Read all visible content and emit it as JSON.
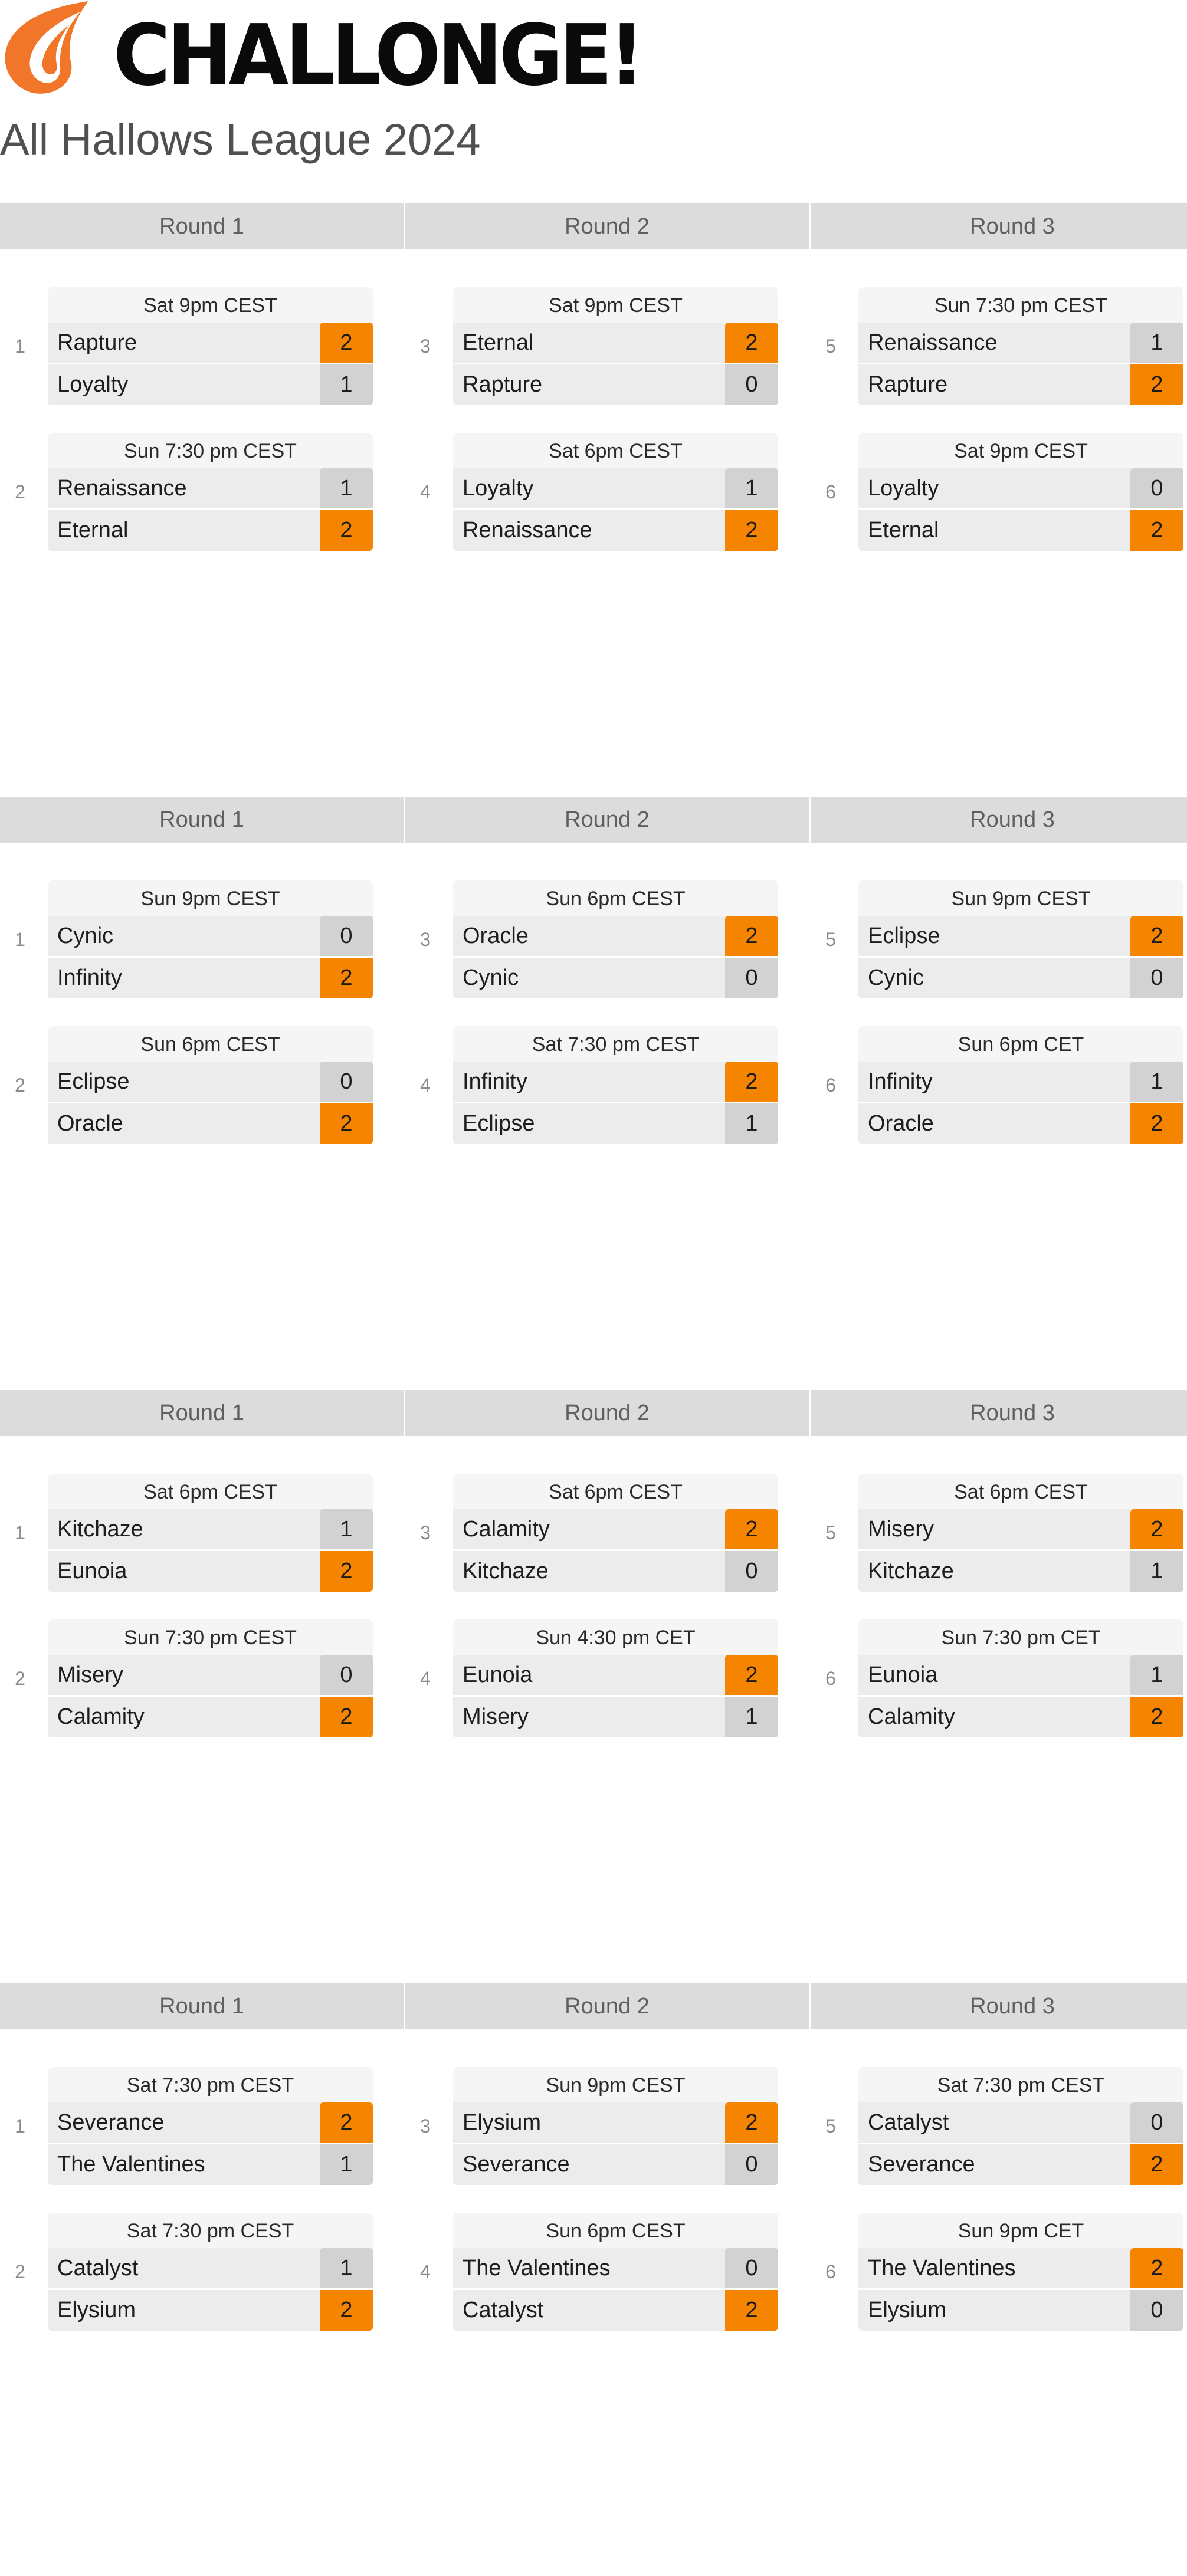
{
  "brand": {
    "name": "CHALLONGE!",
    "logo_icon": "challonge-flame-logo-icon",
    "accent_color": "#f58500"
  },
  "page": {
    "title": "All Hallows League 2024"
  },
  "groups": [
    {
      "rounds": [
        "Round 1",
        "Round 2",
        "Round 3"
      ],
      "matches": [
        {
          "num": "1",
          "time": "Sat 9pm CEST",
          "p1": "Rapture",
          "s1": "2",
          "w1": true,
          "p2": "Loyalty",
          "s2": "1",
          "w2": false
        },
        {
          "num": "2",
          "time": "Sun 7:30 pm CEST",
          "p1": "Renaissance",
          "s1": "1",
          "w1": false,
          "p2": "Eternal",
          "s2": "2",
          "w2": true
        },
        {
          "num": "3",
          "time": "Sat 9pm CEST",
          "p1": "Eternal",
          "s1": "2",
          "w1": true,
          "p2": "Rapture",
          "s2": "0",
          "w2": false
        },
        {
          "num": "4",
          "time": "Sat 6pm CEST",
          "p1": "Loyalty",
          "s1": "1",
          "w1": false,
          "p2": "Renaissance",
          "s2": "2",
          "w2": true
        },
        {
          "num": "5",
          "time": "Sun 7:30 pm CEST",
          "p1": "Renaissance",
          "s1": "1",
          "w1": false,
          "p2": "Rapture",
          "s2": "2",
          "w2": true
        },
        {
          "num": "6",
          "time": "Sat 9pm CEST",
          "p1": "Loyalty",
          "s1": "0",
          "w1": false,
          "p2": "Eternal",
          "s2": "2",
          "w2": true
        }
      ]
    },
    {
      "rounds": [
        "Round 1",
        "Round 2",
        "Round 3"
      ],
      "matches": [
        {
          "num": "1",
          "time": "Sun 9pm CEST",
          "p1": "Cynic",
          "s1": "0",
          "w1": false,
          "p2": "Infinity",
          "s2": "2",
          "w2": true
        },
        {
          "num": "2",
          "time": "Sun 6pm CEST",
          "p1": "Eclipse",
          "s1": "0",
          "w1": false,
          "p2": "Oracle",
          "s2": "2",
          "w2": true
        },
        {
          "num": "3",
          "time": "Sun 6pm CEST",
          "p1": "Oracle",
          "s1": "2",
          "w1": true,
          "p2": "Cynic",
          "s2": "0",
          "w2": false
        },
        {
          "num": "4",
          "time": "Sat 7:30 pm CEST",
          "p1": "Infinity",
          "s1": "2",
          "w1": true,
          "p2": "Eclipse",
          "s2": "1",
          "w2": false
        },
        {
          "num": "5",
          "time": "Sun 9pm CEST",
          "p1": "Eclipse",
          "s1": "2",
          "w1": true,
          "p2": "Cynic",
          "s2": "0",
          "w2": false
        },
        {
          "num": "6",
          "time": "Sun 6pm CET",
          "p1": "Infinity",
          "s1": "1",
          "w1": false,
          "p2": "Oracle",
          "s2": "2",
          "w2": true
        }
      ]
    },
    {
      "rounds": [
        "Round 1",
        "Round 2",
        "Round 3"
      ],
      "matches": [
        {
          "num": "1",
          "time": "Sat 6pm CEST",
          "p1": "Kitchaze",
          "s1": "1",
          "w1": false,
          "p2": "Eunoia",
          "s2": "2",
          "w2": true
        },
        {
          "num": "2",
          "time": "Sun 7:30 pm CEST",
          "p1": "Misery",
          "s1": "0",
          "w1": false,
          "p2": "Calamity",
          "s2": "2",
          "w2": true
        },
        {
          "num": "3",
          "time": "Sat 6pm CEST",
          "p1": "Calamity",
          "s1": "2",
          "w1": true,
          "p2": "Kitchaze",
          "s2": "0",
          "w2": false
        },
        {
          "num": "4",
          "time": "Sun 4:30 pm CET",
          "p1": "Eunoia",
          "s1": "2",
          "w1": true,
          "p2": "Misery",
          "s2": "1",
          "w2": false
        },
        {
          "num": "5",
          "time": "Sat 6pm CEST",
          "p1": "Misery",
          "s1": "2",
          "w1": true,
          "p2": "Kitchaze",
          "s2": "1",
          "w2": false
        },
        {
          "num": "6",
          "time": "Sun 7:30 pm CET",
          "p1": "Eunoia",
          "s1": "1",
          "w1": false,
          "p2": "Calamity",
          "s2": "2",
          "w2": true
        }
      ]
    },
    {
      "rounds": [
        "Round 1",
        "Round 2",
        "Round 3"
      ],
      "matches": [
        {
          "num": "1",
          "time": "Sat 7:30 pm CEST",
          "p1": "Severance",
          "s1": "2",
          "w1": true,
          "p2": "The Valentines",
          "s2": "1",
          "w2": false
        },
        {
          "num": "2",
          "time": "Sat 7:30 pm CEST",
          "p1": "Catalyst",
          "s1": "1",
          "w1": false,
          "p2": "Elysium",
          "s2": "2",
          "w2": true
        },
        {
          "num": "3",
          "time": "Sun 9pm CEST",
          "p1": "Elysium",
          "s1": "2",
          "w1": true,
          "p2": "Severance",
          "s2": "0",
          "w2": false
        },
        {
          "num": "4",
          "time": "Sun 6pm CEST",
          "p1": "The Valentines",
          "s1": "0",
          "w1": false,
          "p2": "Catalyst",
          "s2": "2",
          "w2": true
        },
        {
          "num": "5",
          "time": "Sat 7:30 pm CEST",
          "p1": "Catalyst",
          "s1": "0",
          "w1": false,
          "p2": "Severance",
          "s2": "2",
          "w2": true
        },
        {
          "num": "6",
          "time": "Sun 9pm CET",
          "p1": "The Valentines",
          "s1": "2",
          "w1": true,
          "p2": "Elysium",
          "s2": "0",
          "w2": false
        }
      ]
    }
  ]
}
